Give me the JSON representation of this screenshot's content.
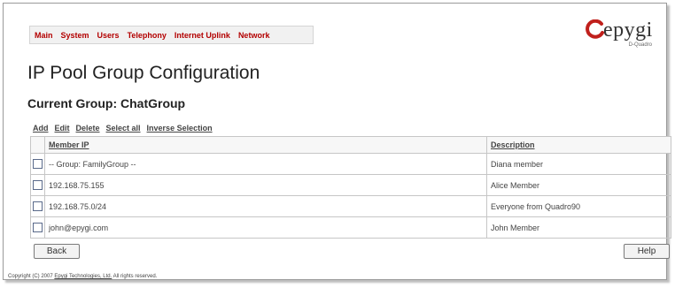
{
  "nav": {
    "items": [
      "Main",
      "System",
      "Users",
      "Telephony",
      "Internet Uplink",
      "Network"
    ]
  },
  "logo": {
    "word": "epygi",
    "sub": "D-Quadro"
  },
  "page": {
    "title": "IP Pool Group Configuration",
    "group_title": "Current Group: ChatGroup"
  },
  "actions": [
    "Add",
    "Edit",
    "Delete",
    "Select all",
    "Inverse Selection"
  ],
  "table": {
    "headers": [
      "Member IP",
      "Description"
    ],
    "rows": [
      {
        "ip": "-- Group: FamilyGroup --",
        "desc": "Diana member"
      },
      {
        "ip": "192.168.75.155",
        "desc": "Alice Member"
      },
      {
        "ip": "192.168.75.0/24",
        "desc": "Everyone from Quadro90"
      },
      {
        "ip": "john@epygi.com",
        "desc": "John Member"
      }
    ]
  },
  "buttons": {
    "back": "Back",
    "help": "Help"
  },
  "footer": {
    "prefix": "Copyright (C) 2007",
    "company": "Epygi Technologies, Ltd.",
    "suffix": "All rights reserved."
  },
  "colors": {
    "nav_text": "#b30000",
    "logo_red": "#c0201c"
  }
}
